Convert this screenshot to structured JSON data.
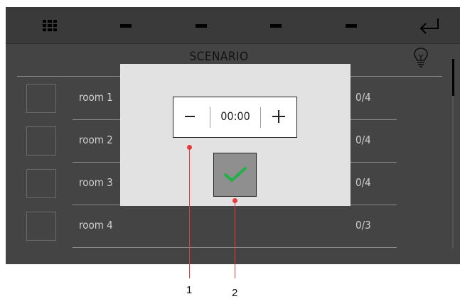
{
  "screen": {
    "title": "SCENARIO",
    "topbar_icons": [
      "grid-icon",
      "dash-icon",
      "dash-icon",
      "dash-icon",
      "dash-icon",
      "enter-icon"
    ],
    "header_icon": "lightbulb-icon",
    "rooms": [
      {
        "name": "room 1",
        "count": "0/4"
      },
      {
        "name": "room 2",
        "count": "0/4"
      },
      {
        "name": "room 3",
        "count": "0/4"
      },
      {
        "name": "room 4",
        "count": "0/3"
      }
    ]
  },
  "dialog": {
    "time_value": "00:00",
    "minus_icon": "minus-icon",
    "plus_icon": "plus-icon",
    "confirm_icon": "checkmark-icon"
  },
  "callouts": [
    "1",
    "2"
  ],
  "colors": {
    "screen_bg": "#444444",
    "dialog_bg": "#e2e2e2",
    "confirm_bg": "#8f8f8f",
    "check_green": "#22b04b",
    "callout_red": "#e43b3b"
  }
}
